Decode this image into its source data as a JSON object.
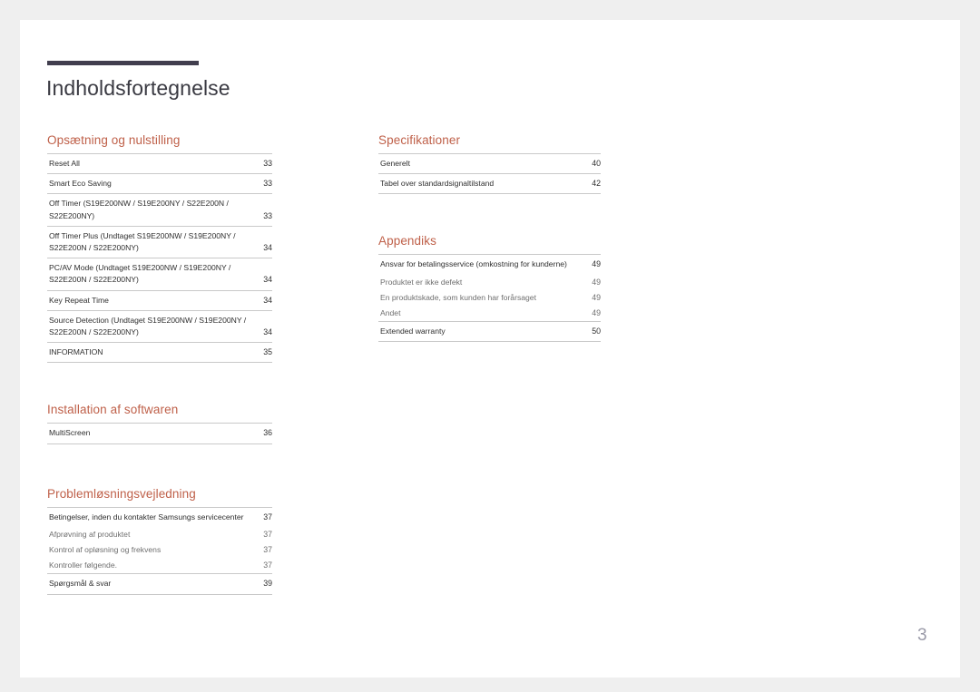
{
  "document": {
    "title": "Indholdsfortegnelse",
    "page_number": "3"
  },
  "colors": {
    "accent": "#bf6049",
    "rule": "#413e4e",
    "divider": "#c9c9c9",
    "text": "#2f2f2f",
    "subtext": "#6f6f6f",
    "page_number": "#9a9aa8",
    "page_background": "#ffffff",
    "canvas_background": "#efefef"
  },
  "left_column": [
    {
      "heading": "Opsætning og nulstilling",
      "groups": [
        {
          "entries": [
            {
              "text": "Reset All",
              "page": "33",
              "level": "main"
            }
          ]
        },
        {
          "entries": [
            {
              "text": "Smart Eco Saving",
              "page": "33",
              "level": "main"
            }
          ]
        },
        {
          "entries": [
            {
              "text": "Off Timer (S19E200NW / S19E200NY / S22E200N / S22E200NY)",
              "page": "33",
              "level": "main"
            }
          ]
        },
        {
          "entries": [
            {
              "text": "Off Timer Plus (Undtaget S19E200NW / S19E200NY / S22E200N / S22E200NY)",
              "page": "34",
              "level": "main"
            }
          ]
        },
        {
          "entries": [
            {
              "text": "PC/AV Mode (Undtaget S19E200NW / S19E200NY / S22E200N / S22E200NY)",
              "page": "34",
              "level": "main"
            }
          ]
        },
        {
          "entries": [
            {
              "text": "Key Repeat Time",
              "page": "34",
              "level": "main"
            }
          ]
        },
        {
          "entries": [
            {
              "text": "Source Detection (Undtaget S19E200NW / S19E200NY / S22E200N / S22E200NY)",
              "page": "34",
              "level": "main"
            }
          ]
        },
        {
          "entries": [
            {
              "text": "INFORMATION",
              "page": "35",
              "level": "main"
            }
          ]
        }
      ]
    },
    {
      "heading": "Installation af softwaren",
      "groups": [
        {
          "entries": [
            {
              "text": "MultiScreen",
              "page": "36",
              "level": "main"
            }
          ]
        }
      ]
    },
    {
      "heading": "Problemløsningsvejledning",
      "groups": [
        {
          "entries": [
            {
              "text": "Betingelser, inden du kontakter Samsungs servicecenter",
              "page": "37",
              "level": "main"
            },
            {
              "text": "Afprøvning af produktet",
              "page": "37",
              "level": "sub"
            },
            {
              "text": "Kontrol af opløsning og frekvens",
              "page": "37",
              "level": "sub"
            },
            {
              "text": "Kontroller følgende.",
              "page": "37",
              "level": "sub"
            }
          ]
        },
        {
          "entries": [
            {
              "text": "Spørgsmål & svar",
              "page": "39",
              "level": "main"
            }
          ]
        }
      ]
    }
  ],
  "right_column": [
    {
      "heading": "Specifikationer",
      "groups": [
        {
          "entries": [
            {
              "text": "Generelt",
              "page": "40",
              "level": "main"
            }
          ]
        },
        {
          "entries": [
            {
              "text": "Tabel over standardsignaltilstand",
              "page": "42",
              "level": "main"
            }
          ]
        }
      ]
    },
    {
      "heading": "Appendiks",
      "groups": [
        {
          "entries": [
            {
              "text": "Ansvar for betalingsservice (omkostning for kunderne)",
              "page": "49",
              "level": "main"
            },
            {
              "text": "Produktet er ikke defekt",
              "page": "49",
              "level": "sub"
            },
            {
              "text": "En produktskade, som kunden har forårsaget",
              "page": "49",
              "level": "sub"
            },
            {
              "text": "Andet",
              "page": "49",
              "level": "sub"
            }
          ]
        },
        {
          "entries": [
            {
              "text": "Extended warranty",
              "page": "50",
              "level": "main"
            }
          ]
        }
      ]
    }
  ]
}
